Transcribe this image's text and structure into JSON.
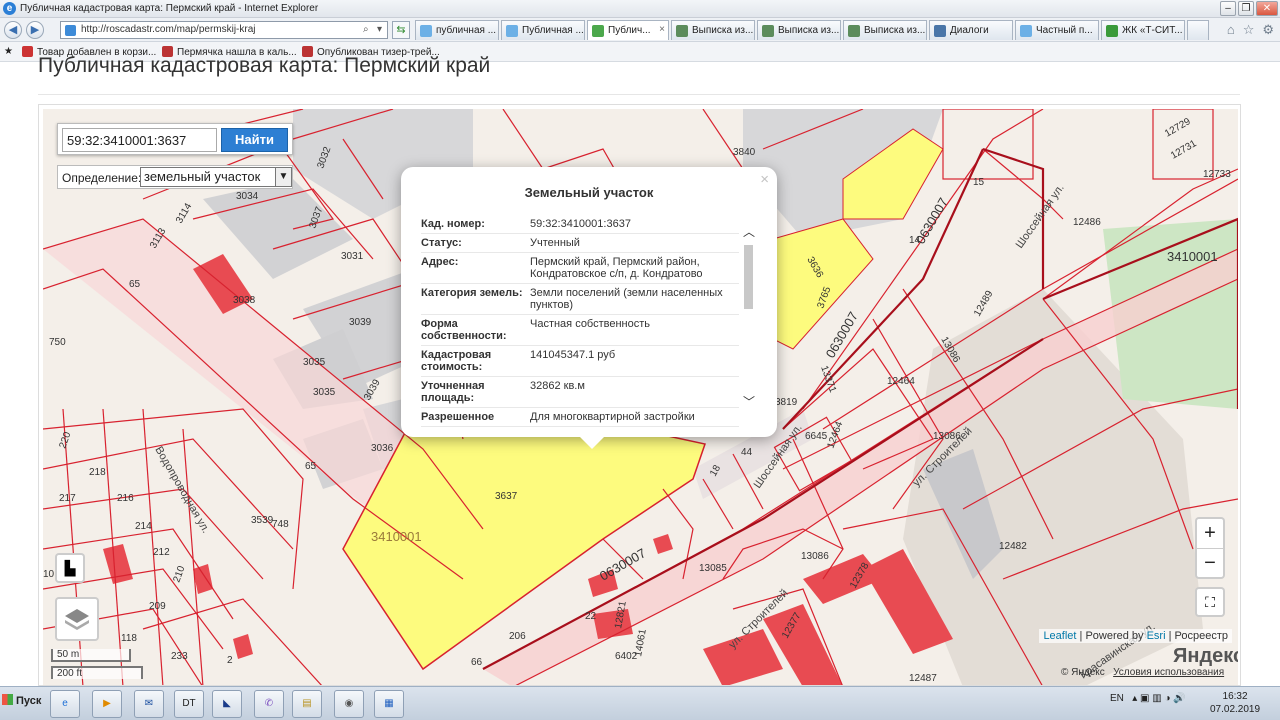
{
  "window": {
    "title": "Публичная кадастровая карта: Пермский край - Internet Explorer"
  },
  "browser": {
    "url": "http://roscadastr.com/map/permskij-kraj",
    "tabs": [
      {
        "label": "публичная ...",
        "active": false
      },
      {
        "label": "Публичная ...",
        "active": false
      },
      {
        "label": "Публич...",
        "active": true
      },
      {
        "label": "Выписка из...",
        "active": false
      },
      {
        "label": "Выписка из...",
        "active": false
      },
      {
        "label": "Выписка из...",
        "active": false
      },
      {
        "label": "Диалоги",
        "active": false
      },
      {
        "label": "Частный п...",
        "active": false
      },
      {
        "label": "ЖК «Т-СИТ...",
        "active": false
      }
    ],
    "favorites": [
      "Товар добавлен в корзи...",
      "Пермячка нашла в каль...",
      "Опубликован тизер-трей..."
    ]
  },
  "page": {
    "title": "Публичная кадастровая карта: Пермский край"
  },
  "search": {
    "value": "59:32:3410001:3637",
    "button": "Найти"
  },
  "definition": {
    "label": "Определение:",
    "selected": "земельный участок"
  },
  "popup": {
    "title": "Земельный участок",
    "close": "×",
    "rows": [
      {
        "key": "Кад. номер:",
        "value": "59:32:3410001:3637"
      },
      {
        "key": "Статус:",
        "value": "Учтенный"
      },
      {
        "key": "Адрес:",
        "value": "Пермский край, Пермский район, Кондратовское с/п, д. Кондратово"
      },
      {
        "key": "Категория земель:",
        "value": "Земли поселений (земли населенных пунктов)"
      },
      {
        "key": "Форма собственности:",
        "value": "Частная собственность"
      },
      {
        "key": "Кадастровая стоимость:",
        "value": "141045347.1 руб"
      },
      {
        "key": "Уточненная площадь:",
        "value": "32862 кв.м"
      },
      {
        "key": "Разрешенное",
        "value": "Для многоквартирной застройки"
      }
    ]
  },
  "map": {
    "labels": {
      "street_vodoprovodnaya": "Водопроводная ул.",
      "street_shosseynaya": "Шоссейная ул.",
      "street_shosseynaya2": "Шоссейная ул.",
      "street_stroiteley": "ул. Строителей",
      "street_stroiteley2": "ул. Строителей",
      "street_krasavinskaya": "Красавинская ул.",
      "quarter_main": "3410001",
      "quarter_right": "3410001",
      "kadnum_0630007_a": "0630007",
      "kadnum_0630007_b": "0630007",
      "kadnum_0630007_c": "0630007",
      "parcel_3637": "3637",
      "parcel_3840": "3840",
      "parcel_3034": "3034",
      "parcel_3032": "3032",
      "parcel_3037": "3037",
      "parcel_3031": "3031",
      "parcel_3114": "3114",
      "parcel_3113": "3113",
      "parcel_3038": "3038",
      "parcel_3039": "3039",
      "parcel_3035a": "3035",
      "parcel_3035b": "3035",
      "parcel_3036": "3036",
      "parcel_3539": "3539",
      "parcel_748": "748",
      "parcel_750": "750",
      "parcel_65a": "65",
      "parcel_65b": "65",
      "parcel_12486": "12486",
      "parcel_12489": "12489",
      "parcel_12733": "12733",
      "parcel_12729": "12729",
      "parcel_12731": "12731",
      "parcel_13086a": "13086",
      "parcel_13086b": "13086",
      "parcel_13086c": "13086",
      "parcel_12482": "12482",
      "parcel_12487": "12487",
      "parcel_13085": "13085",
      "parcel_6645": "6645",
      "parcel_6402": "6402",
      "parcel_3819": "3819",
      "parcel_3765": "3765",
      "parcel_3636": "3636",
      "parcel_12464a": "12464",
      "parcel_12464b": "12464",
      "parcel_13371": "13371",
      "parcel_14": "14",
      "parcel_15": "15",
      "parcel_44": "44",
      "parcel_18": "18",
      "parcel_22": "22",
      "parcel_206": "206",
      "parcel_66": "66",
      "parcel_10": "10",
      "parcel_220": "220",
      "parcel_218": "218",
      "parcel_217": "217",
      "parcel_216": "216",
      "parcel_214": "214",
      "parcel_212": "212",
      "parcel_210": "210",
      "parcel_209": "209",
      "parcel_118": "118",
      "parcel_233": "233",
      "parcel_2": "2",
      "parcel_12821": "12821",
      "parcel_14061": "14061",
      "parcel_12378": "12378",
      "parcel_12377": "12377"
    },
    "zoom_in": "+",
    "zoom_out": "−",
    "scale_m": "50 m",
    "scale_ft": "200 ft",
    "attribution": {
      "leaflet": "Leaflet",
      "sep1": " | Powered by ",
      "esri": "Esri",
      "sep2": " | Росреестр"
    },
    "yandex_logo": "Яндекс",
    "yandex_copy": "© Яндекс",
    "yandex_terms": "Условия использования"
  },
  "taskbar": {
    "start": "Пуск",
    "lang": "EN",
    "time": "16:32",
    "date": "07.02.2019"
  },
  "colors": {
    "parcel_yellow": "#fdfb7e",
    "boundary_red": "#d8222f",
    "building_red": "#e84b52",
    "popup_bg": "#ffffff",
    "button_blue": "#2d7fd3"
  }
}
